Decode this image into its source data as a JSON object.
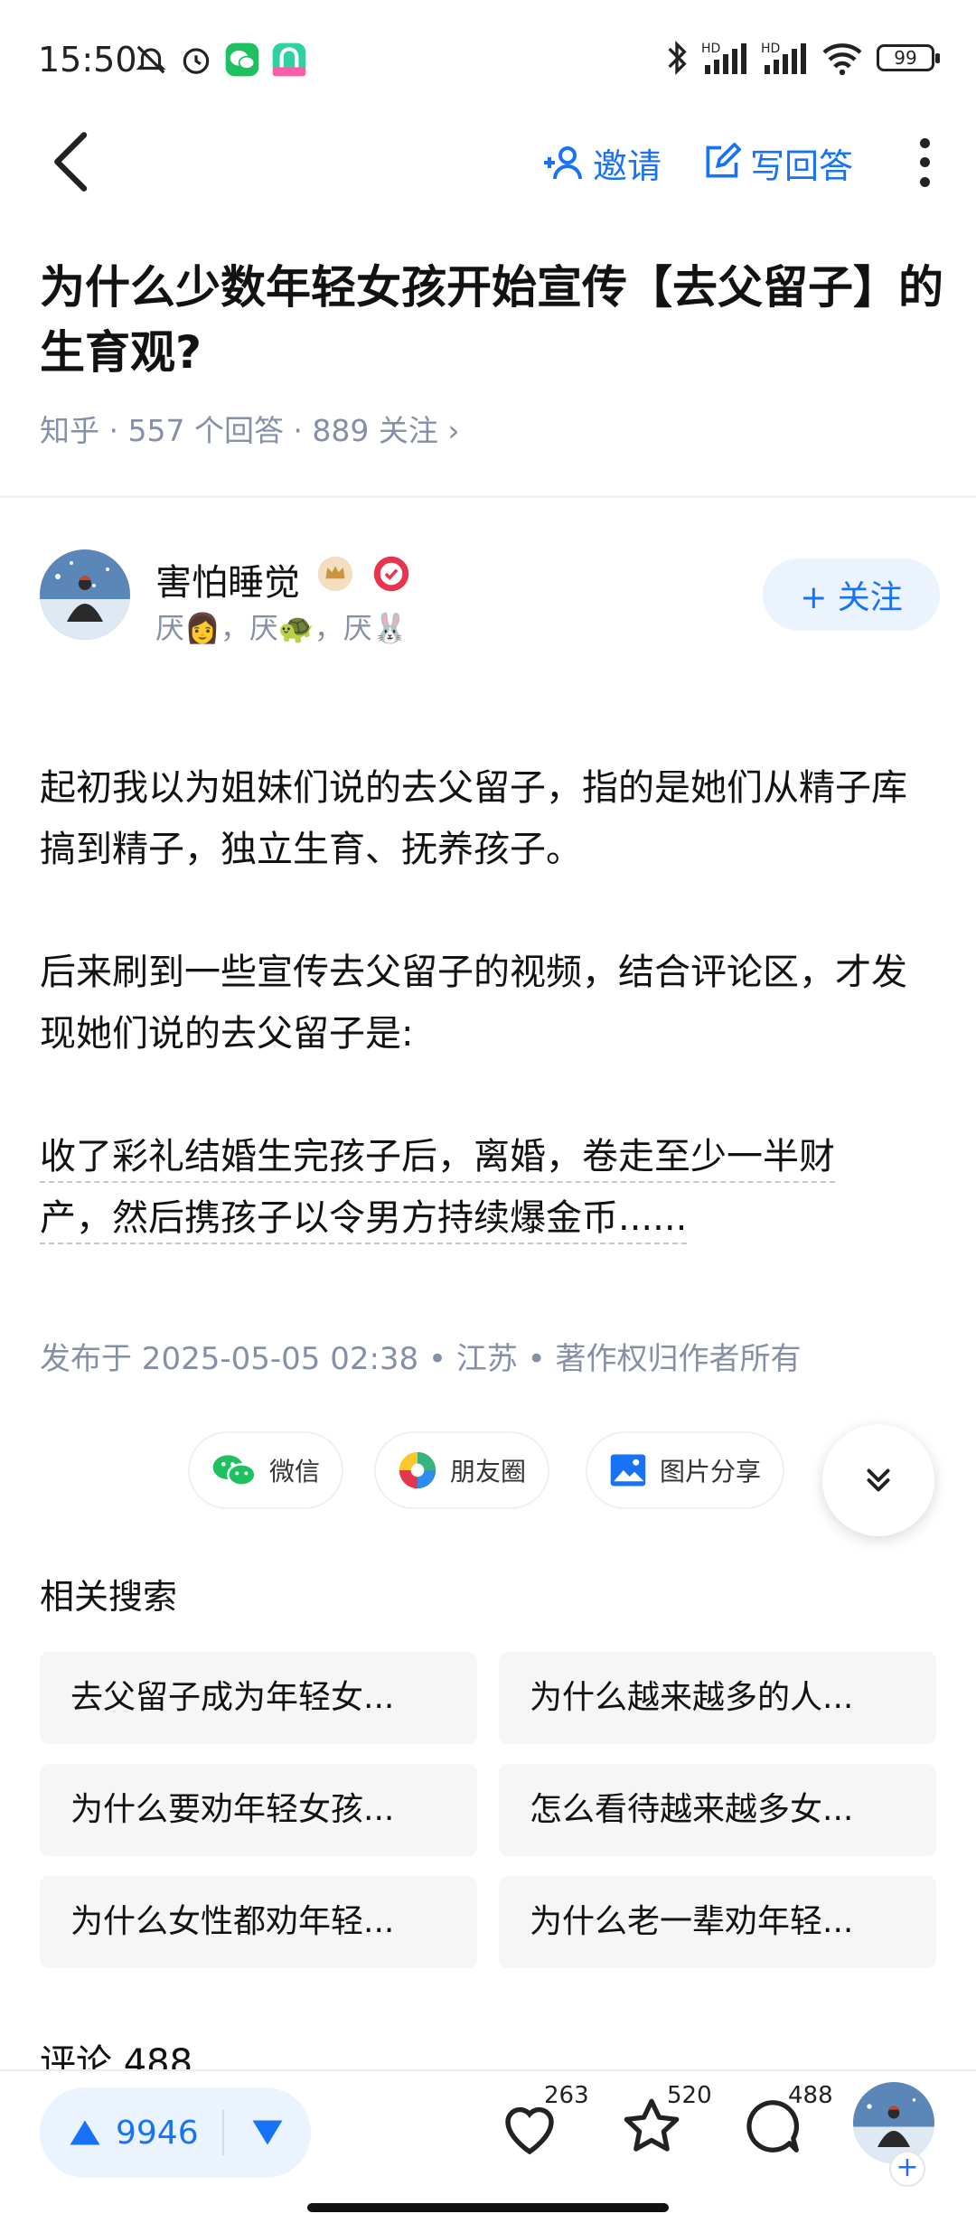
{
  "status": {
    "time": "15:50",
    "battery": "99",
    "network_labels": [
      "HD",
      "HD"
    ]
  },
  "nav": {
    "invite_label": "邀请",
    "write_answer_label": "写回答"
  },
  "question": {
    "title": "为什么少数年轻女孩开始宣传【去父留子】的生育观?",
    "meta": "知乎 · 557 个回答 · 889 关注 ›"
  },
  "author": {
    "name": "害怕睡觉",
    "bio": "厌👩，厌🐢，厌🐰",
    "follow_label": "+ 关注"
  },
  "answer": {
    "paragraphs": [
      "起初我以为姐妹们说的去父留子，指的是她们从精子库搞到精子，独立生育、抚养孩子。",
      "后来刷到一些宣传去父留子的视频，结合评论区，才发现她们说的去父留子是:"
    ],
    "highlight_line_1": "收了彩礼结婚生完孩子后，离婚，卷走至少一半财",
    "highlight_line_2": "产，然后携孩子以令男方持续爆金币......",
    "publish_meta": "发布于 2025-05-05 02:38 • 江苏 • 著作权归作者所有"
  },
  "share": {
    "wechat": "微信",
    "moments": "朋友圈",
    "image_share": "图片分享"
  },
  "related": {
    "title": "相关搜索",
    "items": [
      "去父留子成为年轻女...",
      "为什么越来越多的人...",
      "为什么要劝年轻女孩...",
      "怎么看待越来越多女...",
      "为什么女性都劝年轻...",
      "为什么老一辈劝年轻..."
    ]
  },
  "comments": {
    "heading": "评论 488"
  },
  "bottom_bar": {
    "upvotes": "9946",
    "likes": "263",
    "favorites": "520",
    "comments": "488"
  },
  "colors": {
    "accent": "#1772f6",
    "accent_light": "#ebf3ff",
    "meta_gray": "#8590a6"
  }
}
